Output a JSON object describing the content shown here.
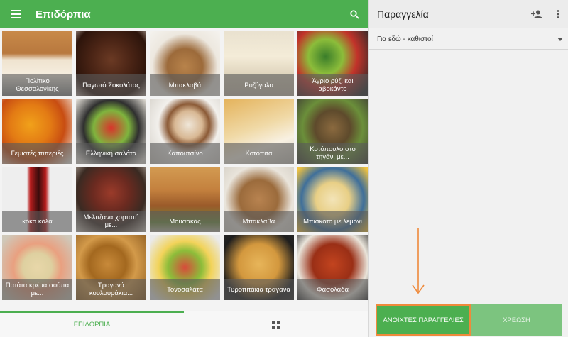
{
  "left": {
    "title": "Επιδόρπια",
    "tiles": [
      {
        "label": "Πολίτικο Θεσσαλονίκης",
        "bg": "linear-gradient(180deg,#c98a4a 0%,#b8783e 35%,#efe3cf 45%,#f6eee0 70%,#8d8d8d 100%)"
      },
      {
        "label": "Παγωτό Σοκολάτας",
        "bg": "radial-gradient(circle at 50% 45%,#6b3a24 0%,#4a2415 40%,#2c140b 75%,#b9aaa1 100%)"
      },
      {
        "label": "Μπακλαβά",
        "bg": "radial-gradient(circle at 50% 55%,#b8834b 0%,#9c6a3a 35%,#ede8df 65%,#f5f3ef 100%)"
      },
      {
        "label": "Ρυζόγαλο",
        "bg": "linear-gradient(180deg,#e9e1cf 0%,#f4ecd8 40%,#ddd2ba 70%,#c9bfae 100%)"
      },
      {
        "label": "Άγριο ρύζι και αβοκάντο",
        "bg": "radial-gradient(circle at 40% 40%,#3a7d2a 0%,#8cbd3a 30%,#c2332a 55%,#2a2a2a 90%)"
      },
      {
        "label": "Γεμιστές πιπεριές",
        "bg": "radial-gradient(circle at 40% 40%,#f1a11a 0%,#e37b14 35%,#c84d12 60%,#f3efe6 95%)"
      },
      {
        "label": "Ελληνική σαλάτα",
        "bg": "radial-gradient(circle at 50% 45%,#d9342b 0%,#7fb43e 35%,#2f2f2f 55%,#e6e2da 90%)"
      },
      {
        "label": "Καπουτσίνο",
        "bg": "radial-gradient(circle at 55% 40%,#efe6d8 0%,#d8b894 25%,#8b5a36 38%,#f2f0ec 55%,#cfcac2 100%)"
      },
      {
        "label": "Κοτόπιτα",
        "bg": "linear-gradient(160deg,#e4b25a 0%,#f0d9a6 45%,#f8f1e3 70%,#c9c4ba 100%)"
      },
      {
        "label": "Κοτόπουλο στο τηγάνι με...",
        "bg": "radial-gradient(circle at 50% 45%,#8b6a3f 0%,#5e4a2c 35%,#6b8f3a 60%,#3e3b34 100%)"
      },
      {
        "label": "κόκα κόλα",
        "bg": "linear-gradient(90deg,#eeeeee 0%,#eeeeee 35%,#b81d1d 40%,#3a0c0c 52%,#b81d1d 62%,#eeeeee 68%,#eeeeee 100%)"
      },
      {
        "label": "Μελιτζάνα χορτατή με...",
        "bg": "radial-gradient(circle at 50% 40%,#9b3b2a 0%,#6b2a20 35%,#3a2a22 65%,#d8d0c4 100%)"
      },
      {
        "label": "Μουσακάς",
        "bg": "linear-gradient(180deg,#d39b52 0%,#c4813e 35%,#9a5a2a 60%,#6f8a3a 85%,#bdb6aa 100%)"
      },
      {
        "label": "Μπακλαβά",
        "bg": "radial-gradient(circle at 50% 50%,#b88350 0%,#9b6b3c 40%,#e9e4db 70%,#d9d4ca 100%)"
      },
      {
        "label": "Μπισκότο με λεμόνι",
        "bg": "radial-gradient(circle at 50% 50%,#f3e4b8 0%,#e8cf86 35%,#3f6f9a 65%,#f0c240 95%)"
      },
      {
        "label": "Πατάτα κρέμα σούπα με...",
        "bg": "radial-gradient(circle at 50% 50%,#e8d7a9 0%,#ded0a0 30%,#e9a080 50%,#cfc8b9 90%)"
      },
      {
        "label": "Τραγανά κουλουράκια...",
        "bg": "radial-gradient(circle at 45% 45%,#c88a3a 0%,#a3681f 35%,#d39a4a 55%,#8a5a20 100%)"
      },
      {
        "label": "Τονοσαλάτα",
        "bg": "radial-gradient(circle at 50% 50%,#d84a3a 0%,#8cbd3a 35%,#f2d35a 55%,#eaeaea 90%)"
      },
      {
        "label": "Τυροπιτάκια τραγανά",
        "bg": "radial-gradient(circle at 50% 45%,#e7b55a 0%,#d3983e 40%,#1e1e1e 75%,#2a2a2a 100%)"
      },
      {
        "label": "Φασολάδα",
        "bg": "radial-gradient(circle at 50% 45%,#c3441f 0%,#9a2f16 40%,#e9e4da 70%,#3a3a3a 100%)"
      }
    ],
    "nav": {
      "tab1": "ΕΠΙΔΟΡΠΙΑ"
    }
  },
  "right": {
    "title": "Παραγγελία",
    "order_type": "Για εδώ - καθιστοί",
    "buttons": {
      "open": "ΑΝΟΙΧΤΕΣ ΠΑΡΑΓΓΕΛΙΕΣ",
      "charge": "ΧΡΕΩΣΗ"
    }
  },
  "colors": {
    "primary": "#4caf50",
    "highlight": "#ef8a3b",
    "charge": "#7cc47f"
  },
  "icons": [
    "menu-icon",
    "search-icon",
    "add-person-icon",
    "more-vert-icon",
    "dropdown-caret-icon",
    "grid-view-icon",
    "arrow-down-annotation"
  ]
}
